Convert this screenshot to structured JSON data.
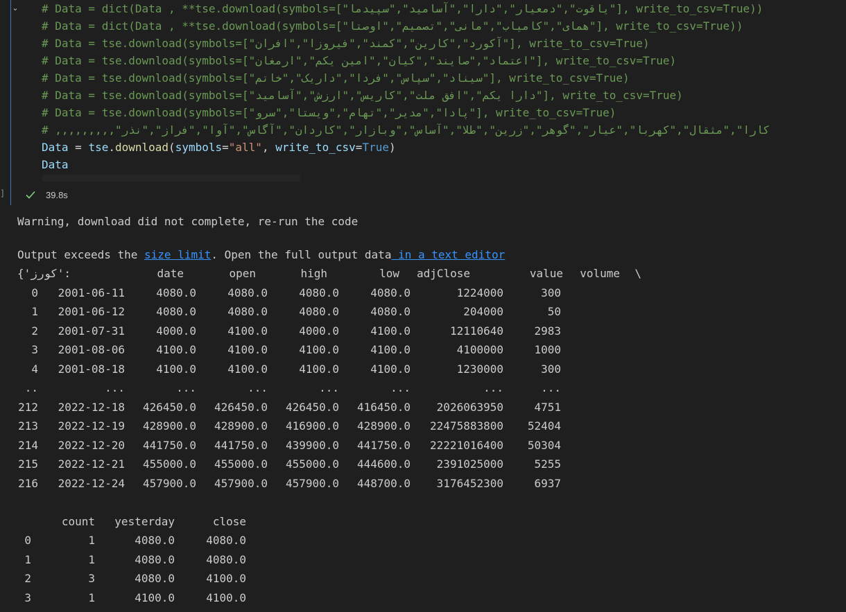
{
  "code_cell": {
    "lines": [
      "# Data = dict(Data , **tse.download(symbols=[\"یاقوت\",\"دمعیار\",\"دارا\",\"آسامید\",\"سپیدما\"], write_to_csv=True))",
      "# Data = dict(Data , **tse.download(symbols=[\"همای\",\"کامیاب\",\"مانی\",\"تصمیم\",\"اوصتا\"], write_to_csv=True))",
      "# Data = tse.download(symbols=[\"آکورد\",\"کارین\",\"کمند\",\"فیروزا\",\"افران\"], write_to_csv=True)",
      "# Data = tse.download(symbols=[\"اعتماد\",\"صایند\",\"کیان\",\"امین یکم\",\"ارمغان\"], write_to_csv=True)",
      "# Data = tse.download(symbols=[\"سیناد\",\"سپاس\",\"فردا\",\"داریک\",\"خاتم\"], write_to_csv=True)",
      "# Data = tse.download(symbols=[\"دارا یکم\",\"افق ملت\",\"کاریس\",\"ارزش\",\"آسامید\"], write_to_csv=True)",
      "# Data = tse.download(symbols=[\"پادا\",\"مدیر\",\"تهام\",\"ویستا\",\"سرو\"], write_to_csv=True)",
      "# ,,,,,,,,,\"کارا\",\"مثقال\",\"کهربا\",\"عیار\",\"گوهر\",\"زرین\",\"طلا\",\"آساس\",\"وبازار\",\"کاردان\",\"آگاس\",\"آوا\",\"فراز\",\"نذر"
    ],
    "active_line": {
      "var": "Data",
      "eq": " = ",
      "obj": "tse",
      "dot": ".",
      "fn": "download",
      "open": "(",
      "kw1": "symbols",
      "eq1": "=",
      "str1": "\"all\"",
      "comma": ", ",
      "kw2": "write_to_csv",
      "eq2": "=",
      "val2": "True",
      "close": ")"
    },
    "last_line": "Data",
    "exec_time": "39.8s",
    "bracket": "]"
  },
  "output": {
    "warning": "Warning, download did not complete, re-run the code",
    "exceeds_prefix": "Output exceeds the ",
    "size_limit_link": "size limit",
    "exceeds_middle": ". Open the full output data",
    "text_editor_link": " in a text editor",
    "dict_prefix": "{'کورز':",
    "table1": {
      "headers": [
        "date",
        "open",
        "high",
        "low",
        "adjClose",
        "value",
        "volume",
        "\\"
      ],
      "rows": [
        [
          "0",
          "2001-06-11",
          "4080.0",
          "4080.0",
          "4080.0",
          "4080.0",
          "1224000",
          "300"
        ],
        [
          "1",
          "2001-06-12",
          "4080.0",
          "4080.0",
          "4080.0",
          "4080.0",
          "204000",
          "50"
        ],
        [
          "2",
          "2001-07-31",
          "4000.0",
          "4100.0",
          "4000.0",
          "4100.0",
          "12110640",
          "2983"
        ],
        [
          "3",
          "2001-08-06",
          "4100.0",
          "4100.0",
          "4100.0",
          "4100.0",
          "4100000",
          "1000"
        ],
        [
          "4",
          "2001-08-18",
          "4100.0",
          "4100.0",
          "4100.0",
          "4100.0",
          "1230000",
          "300"
        ],
        [
          "..",
          "...",
          "...",
          "...",
          "...",
          "...",
          "...",
          "..."
        ],
        [
          "212",
          "2022-12-18",
          "426450.0",
          "426450.0",
          "426450.0",
          "416450.0",
          "2026063950",
          "4751"
        ],
        [
          "213",
          "2022-12-19",
          "428900.0",
          "428900.0",
          "416900.0",
          "428900.0",
          "22475883800",
          "52404"
        ],
        [
          "214",
          "2022-12-20",
          "441750.0",
          "441750.0",
          "439900.0",
          "441750.0",
          "22221016400",
          "50304"
        ],
        [
          "215",
          "2022-12-21",
          "455000.0",
          "455000.0",
          "455000.0",
          "444600.0",
          "2391025000",
          "5255"
        ],
        [
          "216",
          "2022-12-24",
          "457900.0",
          "457900.0",
          "457900.0",
          "448700.0",
          "3176452300",
          "6937"
        ]
      ]
    },
    "table2": {
      "headers": [
        "count",
        "yesterday",
        "close"
      ],
      "rows": [
        [
          "0",
          "1",
          "4080.0",
          "4080.0"
        ],
        [
          "1",
          "1",
          "4080.0",
          "4080.0"
        ],
        [
          "2",
          "3",
          "4080.0",
          "4100.0"
        ],
        [
          "3",
          "1",
          "4100.0",
          "4100.0"
        ]
      ]
    }
  }
}
